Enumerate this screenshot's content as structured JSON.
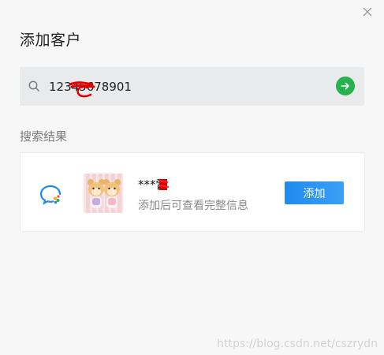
{
  "dialog": {
    "title": "添加客户",
    "close_icon": "close-icon"
  },
  "search": {
    "value": "12345678901",
    "placeholder": "",
    "search_icon": "search-icon",
    "go_icon": "arrow-right-icon",
    "go_color": "#26b24f"
  },
  "results": {
    "label": "搜索结果",
    "items": [
      {
        "source_icon": "wecom-icon",
        "avatar": "avatar",
        "name": "***雷",
        "hint": "添加后可查看完整信息",
        "add_label": "添加"
      }
    ]
  },
  "watermark": "https://blog.csdn.net/cszrydn",
  "colors": {
    "accent": "#1f8af0",
    "background": "#f7f7f7",
    "redaction": "#e00000"
  }
}
